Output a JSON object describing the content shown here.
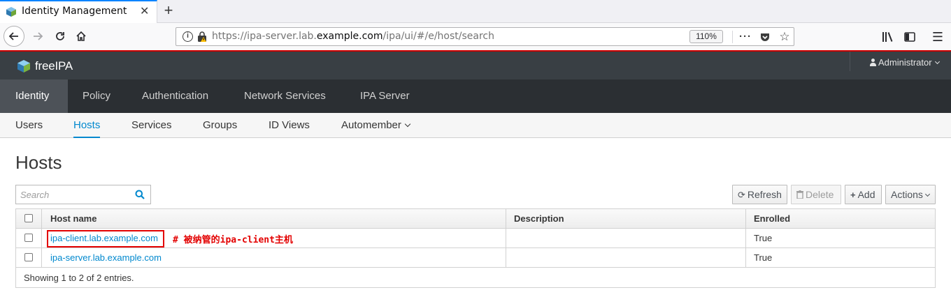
{
  "browser": {
    "tab_title": "Identity Management",
    "tab_close": "✕",
    "new_tab": "+",
    "url_prefix": "https://ipa-server.lab.",
    "url_host": "example.com",
    "url_path": "/ipa/ui/#/e/host/search",
    "zoom": "110%"
  },
  "header": {
    "logo": "freeIPA",
    "user": "Administrator"
  },
  "primary_nav": [
    {
      "label": "Identity",
      "active": true
    },
    {
      "label": "Policy"
    },
    {
      "label": "Authentication"
    },
    {
      "label": "Network Services"
    },
    {
      "label": "IPA Server"
    }
  ],
  "secondary_nav": [
    {
      "label": "Users"
    },
    {
      "label": "Hosts",
      "active": true
    },
    {
      "label": "Services"
    },
    {
      "label": "Groups"
    },
    {
      "label": "ID Views"
    },
    {
      "label": "Automember"
    }
  ],
  "page": {
    "title": "Hosts",
    "search_placeholder": "Search"
  },
  "toolbar": {
    "refresh": "Refresh",
    "delete": "Delete",
    "add": "Add",
    "actions": "Actions"
  },
  "table": {
    "columns": [
      "Host name",
      "Description",
      "Enrolled"
    ],
    "rows": [
      {
        "host": "ipa-client.lab.example.com",
        "description": "",
        "enrolled": "True"
      },
      {
        "host": "ipa-server.lab.example.com",
        "description": "",
        "enrolled": "True"
      }
    ],
    "annotation": "# 被纳管的ipa-client主机",
    "footer": "Showing 1 to 2 of 2 entries."
  },
  "colors": {
    "accent": "#0088ce",
    "header_bg": "#393f44",
    "nav_bg": "#2b2f33",
    "annotation": "#e30000"
  }
}
